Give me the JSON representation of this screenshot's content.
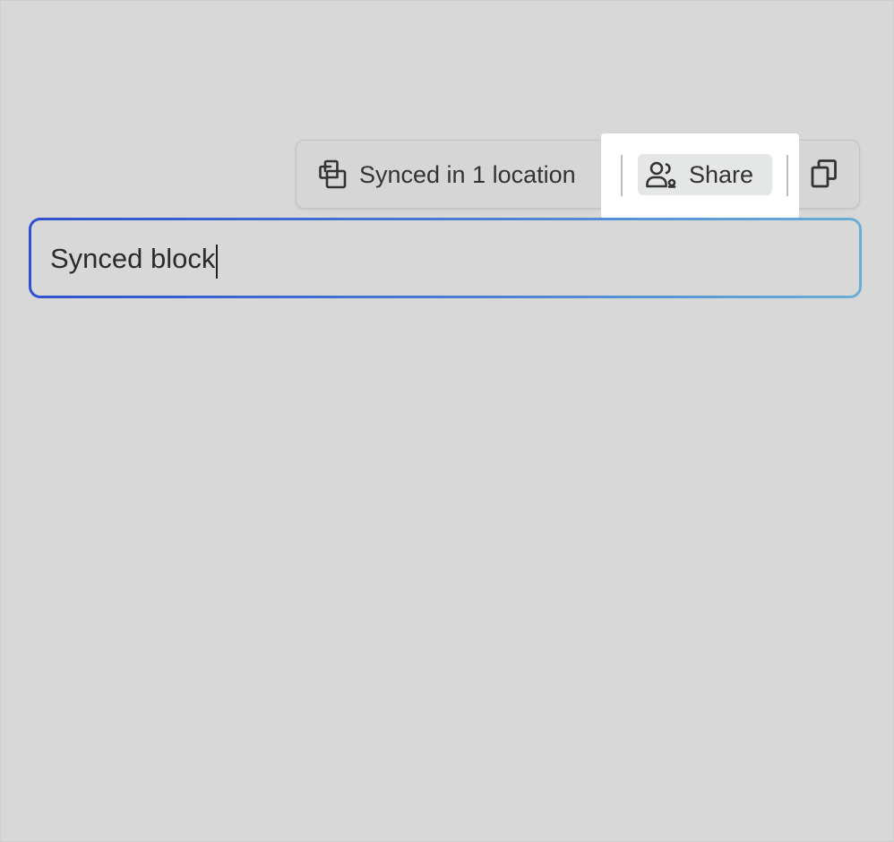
{
  "toolbar": {
    "synced_status_label": "Synced in 1 location",
    "synced_status_icon": "synced-block-icon",
    "share_label": "Share",
    "share_icon": "people-icon",
    "copy_icon": "copy-icon"
  },
  "block": {
    "text": "Synced block"
  },
  "colors": {
    "background": "#d8d8d8",
    "highlight": "#ffffff",
    "border_gradient_start": "#2f4fd0",
    "border_gradient_end": "#6aaed6"
  }
}
